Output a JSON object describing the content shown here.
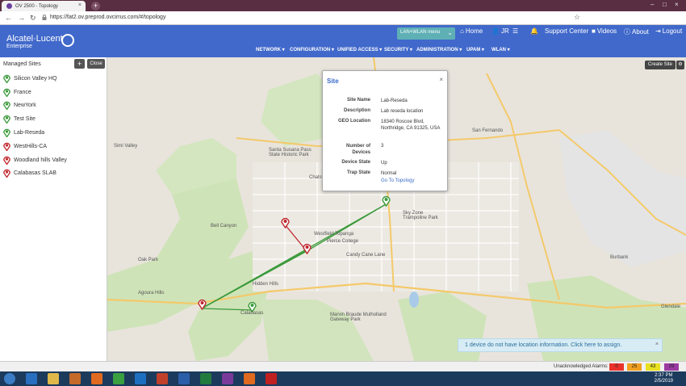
{
  "browser": {
    "tab_title": "OV 2500 - Topology",
    "url": "https://fat2.ov.preprod.ovcirrus.com/#/topology"
  },
  "header": {
    "logo_main": "Alcatel·Lucent",
    "logo_sub": "Enterprise",
    "menu_select": "LAN+WLAN menu",
    "links": [
      "Home",
      "JR",
      "",
      "",
      "Support Center",
      "Videos",
      "About",
      "Logout"
    ],
    "nav": [
      "NETWORK",
      "CONFIGURATION",
      "UNIFIED ACCESS",
      "SECURITY",
      "ADMINISTRATION",
      "UPAM",
      "WLAN"
    ]
  },
  "sidebar": {
    "title": "Managed Sites",
    "add_label": "+",
    "close_label": "Close",
    "sites": [
      {
        "name": "Silicon Valley HQ",
        "color": "#3a9a3a"
      },
      {
        "name": "France",
        "color": "#3a9a3a"
      },
      {
        "name": "NewYork",
        "color": "#3a9a3a"
      },
      {
        "name": "Test Site",
        "color": "#3a9a3a"
      },
      {
        "name": "Lab-Reseda",
        "color": "#3a9a3a"
      },
      {
        "name": "WestHills-CA",
        "color": "#c0272d"
      },
      {
        "name": "Woodland hills Valley",
        "color": "#c0272d"
      },
      {
        "name": "Calabasas SLAB",
        "color": "#c0272d"
      }
    ]
  },
  "map": {
    "create_site": "Create Site",
    "labels": [
      "Simi Valley",
      "Santa Susana Pass State Historic Park",
      "Chatsworth",
      "Bell Canyon",
      "Oak Park",
      "Hidden Hills",
      "Agoura Hills",
      "Calabasas",
      "Sky Zone Trampoline Park",
      "Westfield Topanga",
      "Pierce College",
      "Candy Cane Lane",
      "Marvin Braude Mulholland Gateway Park",
      "Burbank",
      "Glendale",
      "San Fernando"
    ]
  },
  "popup": {
    "title": "Site",
    "close": "×",
    "rows": [
      {
        "key": "Site Name",
        "value": "Lab-Reseda"
      },
      {
        "key": "Description",
        "value": "Lab reseda location"
      },
      {
        "key": "GEO Location",
        "value": "18340 Roscoe Blvd, Northridge, CA 91325, USA"
      },
      {
        "key": "Number of Devices",
        "value": "3"
      },
      {
        "key": "Device State",
        "value": "Up"
      },
      {
        "key": "Trap State",
        "value": "Normal"
      }
    ],
    "goto_label": "Go To Topology"
  },
  "notice": {
    "text": "1 device do not have location information. Click here to assign.",
    "close": "×"
  },
  "alarms": {
    "label": "Unacknowledged Alarms:",
    "counts": [
      {
        "value": "0",
        "color": "#e8322b"
      },
      {
        "value": "25",
        "color": "#f0a020"
      },
      {
        "value": "43",
        "color": "#e8e020"
      },
      {
        "value": "29",
        "color": "#9a3aa0"
      }
    ]
  },
  "taskbar": {
    "time": "2:37 PM",
    "date": "2/5/2019"
  }
}
